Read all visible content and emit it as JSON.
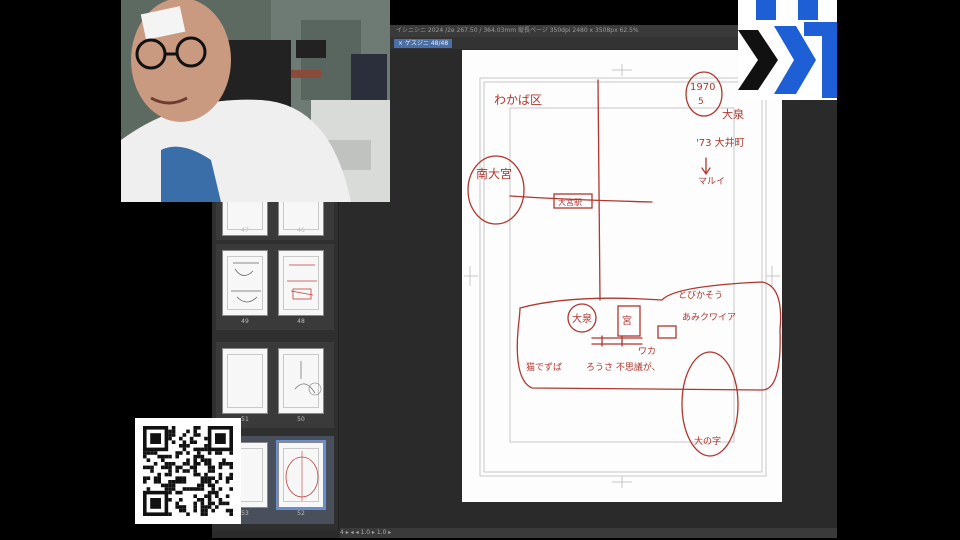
{
  "app": {
    "titlebar_text": "イシニシニ 2024 /2e 267.50 / 364.03mm 縦長ページ 350dpi 2480 x 3508px 62.5%",
    "active_tab": "× ゲスジニ 48/48",
    "statusbar_text": "4  ▸  ◂  ◂  1.0  ▸  1.0  ▸"
  },
  "page_panel": {
    "rows": [
      {
        "left_label": "47",
        "right_label": "46"
      },
      {
        "left_label": "49",
        "right_label": "48"
      },
      {
        "left_label": "51",
        "right_label": "50"
      },
      {
        "left_label": "53",
        "right_label": "52"
      }
    ]
  },
  "sketch": {
    "location_label": "わかば区",
    "ward_label": "南大宮",
    "station_label": "大宮駅",
    "ring_number": "1970\n5\n10",
    "note_right": "大泉",
    "note_line2": "'73 大井町",
    "arrow_note": "マルイ",
    "note_right_big": "とびかそう",
    "balloon_1": "大泉",
    "balloon_2": "宮",
    "side_label": "あみクワイア",
    "caption_a": "猫でずば",
    "caption_b": "ろうさ 不思議が、",
    "caption_c": "ワカ",
    "bottom_label": "大の字"
  },
  "colors": {
    "ink": "#b0362e",
    "logo_blue": "#1f5fd6"
  }
}
